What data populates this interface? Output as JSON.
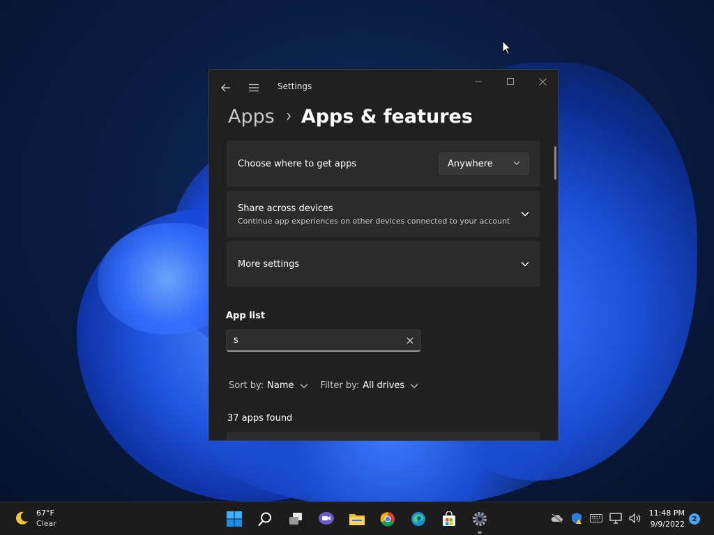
{
  "window": {
    "title": "Settings",
    "breadcrumb": {
      "parent": "Apps",
      "current": "Apps & features"
    }
  },
  "cards": {
    "choose_where": {
      "title": "Choose where to get apps",
      "dropdown_value": "Anywhere"
    },
    "share_across": {
      "title": "Share across devices",
      "subtitle": "Continue app experiences on other devices connected to your account"
    },
    "more_settings": {
      "title": "More settings"
    }
  },
  "app_list": {
    "title": "App list",
    "search_value": "s",
    "sort_label": "Sort by:",
    "sort_value": "Name",
    "filter_label": "Filter by:",
    "filter_value": "All drives",
    "count_text": "37 apps found"
  },
  "taskbar": {
    "weather": {
      "temp": "67°F",
      "condition": "Clear",
      "icon": "moon-icon"
    },
    "apps": [
      "start-icon",
      "search-icon",
      "task-view-icon",
      "chat-icon",
      "file-explorer-icon",
      "chrome-icon",
      "edge-icon",
      "store-icon",
      "settings-icon"
    ],
    "clock": {
      "time": "11:48 PM",
      "date": "9/9/2022"
    },
    "notifications": "2"
  },
  "colors": {
    "window_bg": "#202020",
    "card_bg": "#2b2b2b",
    "accent": "#4aa3f5",
    "taskbar_bg": "#1c1c1c"
  }
}
